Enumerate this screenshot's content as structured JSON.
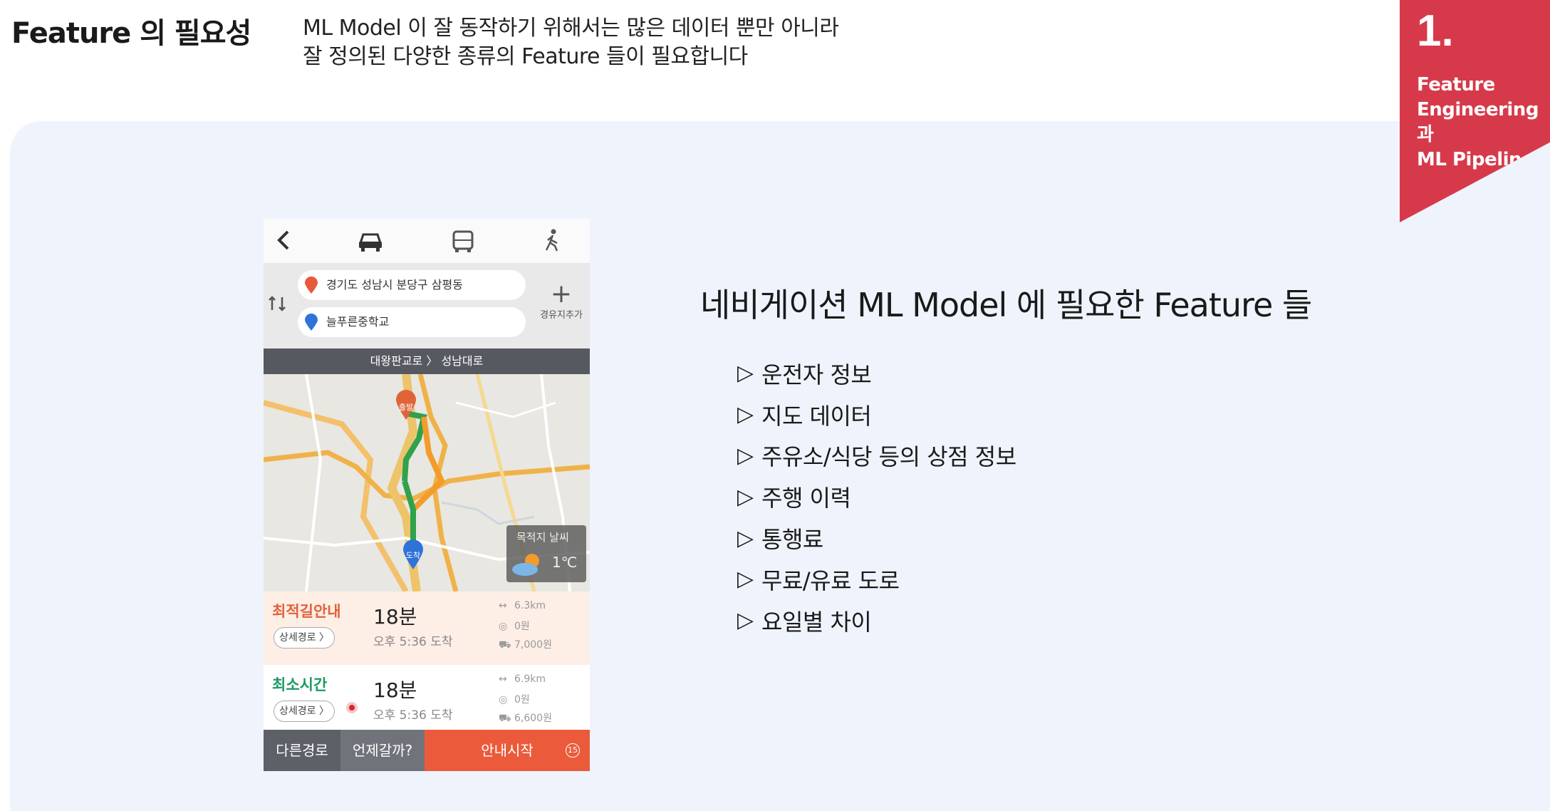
{
  "header": {
    "title": "Feature 의 필요성",
    "subtitle": "ML Model 이 잘 동작하기 위해서는 많은 데이터 뿐만 아니라\n잘 정의된 다양한 종류의 Feature 들이 필요합니다"
  },
  "badge": {
    "number": "1.",
    "text": "Feature\nEngineering 과\nML Pipeline",
    "color": "#d63a4a"
  },
  "phone": {
    "tabs": [
      "back-icon",
      "car-icon",
      "bus-icon",
      "walk-icon"
    ],
    "origin": "경기도 성남시 분당구 삼평동",
    "destination": "늘푸른중학교",
    "add_waypoint": "경유지추가",
    "road_bar": "대왕판교로 〉 성남대로",
    "start_marker": "출발",
    "end_marker": "도착",
    "weather_label": "목적지 날씨",
    "weather_temp": "1℃",
    "routes": [
      {
        "name": "최적길안내",
        "detail": "상세경로 〉",
        "time": "18분",
        "arrive": "오후 5:36 도착",
        "distance": "6.3km",
        "toll": "0원",
        "fuel": "7,000원",
        "color": "#e0633a"
      },
      {
        "name": "최소시간",
        "detail": "상세경로 〉",
        "time": "18분",
        "arrive": "오후 5:36 도착",
        "distance": "6.9km",
        "toll": "0원",
        "fuel": "6,600원",
        "color": "#1c9a63"
      }
    ],
    "bottom": {
      "other": "다른경로",
      "when": "언제갈까?",
      "start": "안내시작",
      "start_count": "15"
    }
  },
  "feature_title": "네비게이션 ML Model 에 필요한 Feature 들",
  "features": [
    "운전자 정보",
    "지도 데이터",
    "주유소/식당 등의 상점 정보",
    "주행 이력",
    "통행료",
    "무료/유료 도로",
    "요일별 차이"
  ],
  "bullet": "▷"
}
